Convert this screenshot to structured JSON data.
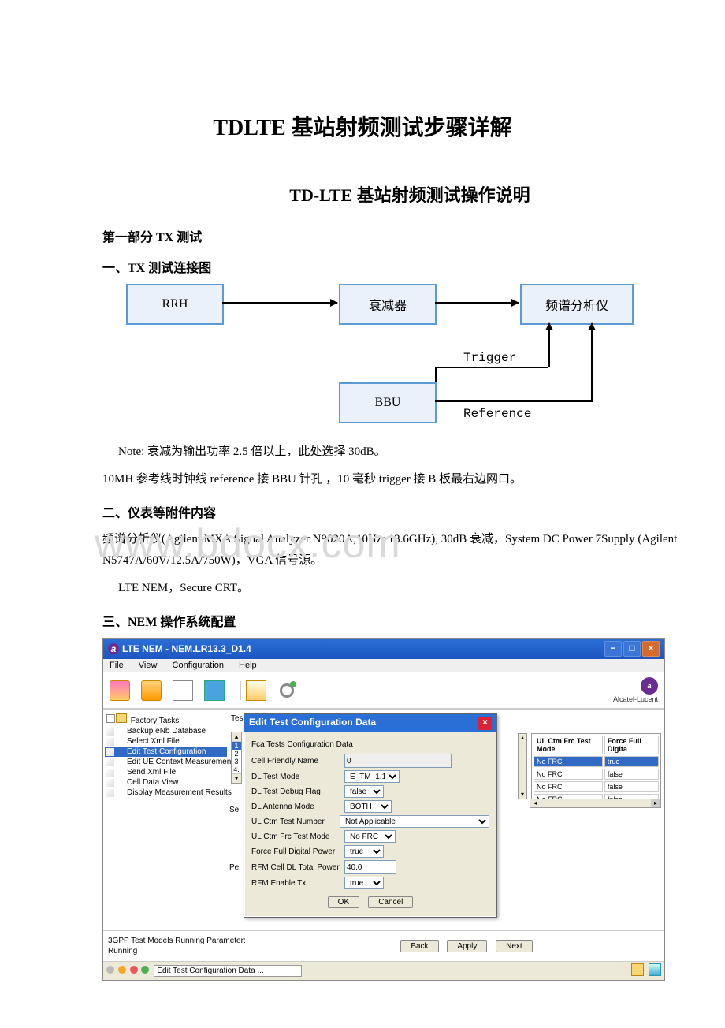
{
  "doc": {
    "title_main": "TDLTE 基站射频测试步骤详解",
    "title_sub": "TD-LTE 基站射频测试操作说明",
    "part_head": "第一部分 TX 测试",
    "s1": "一、TX 测试连接图",
    "s2": "二、仪表等附件内容",
    "s3": "三、NEM 操作系统配置",
    "note1": "Note: 衰减为输出功率 2.5 倍以上，此处选择 30dB。",
    "note2": "10MH 参考线时钟线 reference 接 BBU 针孔   ，10 毫秒 trigger 接 B 板最右边网口。",
    "equip": "频谱分析仪(Agilent MXA Signal Analyzer N9020A,10Hz~13.6GHz), 30dB 衰减，System DC Power 7Supply (Agilent N5747A/60V/12.5A/750W)，VGA 信号源。",
    "sw": "LTE NEM，Secure CRT。",
    "watermark": "www.bdocx.com"
  },
  "diagram": {
    "rrh": "RRH",
    "attenuator": "衰减器",
    "spectrum": "频谱分析仪",
    "bbu": "BBU",
    "trigger": "Trigger",
    "reference": "Reference"
  },
  "app": {
    "title": "LTE NEM  -  NEM.LR13.3_D1.4",
    "menus": [
      "File",
      "View",
      "Configuration",
      "Help"
    ],
    "brand": "Alcatel-Lucent",
    "tree_root": "Factory Tasks",
    "tree_items": [
      "Backup eNb Database",
      "Select Xml File",
      "Edit Test Configuration",
      "Edit UE Context Measurement",
      "Send Xml File",
      "Cell Data View",
      "Display Measurement Results"
    ],
    "tree_selected_index": 2,
    "left_truncated": "Tes",
    "side_nums": [
      "1",
      "2",
      "3",
      "4."
    ],
    "side_se": "Se",
    "side_pe": "Pe",
    "bg_table": {
      "cols": [
        "UL Ctm Frc Test Mode",
        "Force Full Digita"
      ],
      "rows": [
        [
          "No FRC",
          "true"
        ],
        [
          "No FRC",
          "false"
        ],
        [
          "No FRC",
          "false"
        ],
        [
          "No FRC",
          "false"
        ]
      ]
    },
    "dialog": {
      "title": "Edit Test Configuration Data",
      "group": "Fca Tests Configuration Data",
      "fields": {
        "cell_friendly": {
          "label": "Cell Friendly Name",
          "value": "0"
        },
        "dl_test_mode": {
          "label": "DL Test Mode",
          "value": "E_TM_1.1"
        },
        "dl_debug": {
          "label": "DL Test Debug Flag",
          "value": "false"
        },
        "dl_ant": {
          "label": "DL Antenna Mode",
          "value": "BOTH"
        },
        "ul_num": {
          "label": "UL Ctm Test Number",
          "value": "Not Applicable"
        },
        "ul_frc": {
          "label": "UL Ctm Frc Test Mode",
          "value": "No FRC"
        },
        "force_full": {
          "label": "Force Full Digital Power",
          "value": "true"
        },
        "rfm_total": {
          "label": "RFM Cell DL Total Power",
          "value": "40.0"
        },
        "rfm_enable": {
          "label": "RFM Enable Tx",
          "value": "true"
        }
      },
      "ok": "OK",
      "cancel": "Cancel"
    },
    "lower": {
      "param_label": "3GPP Test Models Running Parameter:",
      "param_value": "Running",
      "back": "Back",
      "apply": "Apply",
      "next": "Next"
    },
    "status": {
      "text": "Edit Test Configuration Data ...",
      "dot_colors": [
        "#bbb",
        "#f5a623",
        "#e55",
        "#4caf50"
      ]
    }
  }
}
